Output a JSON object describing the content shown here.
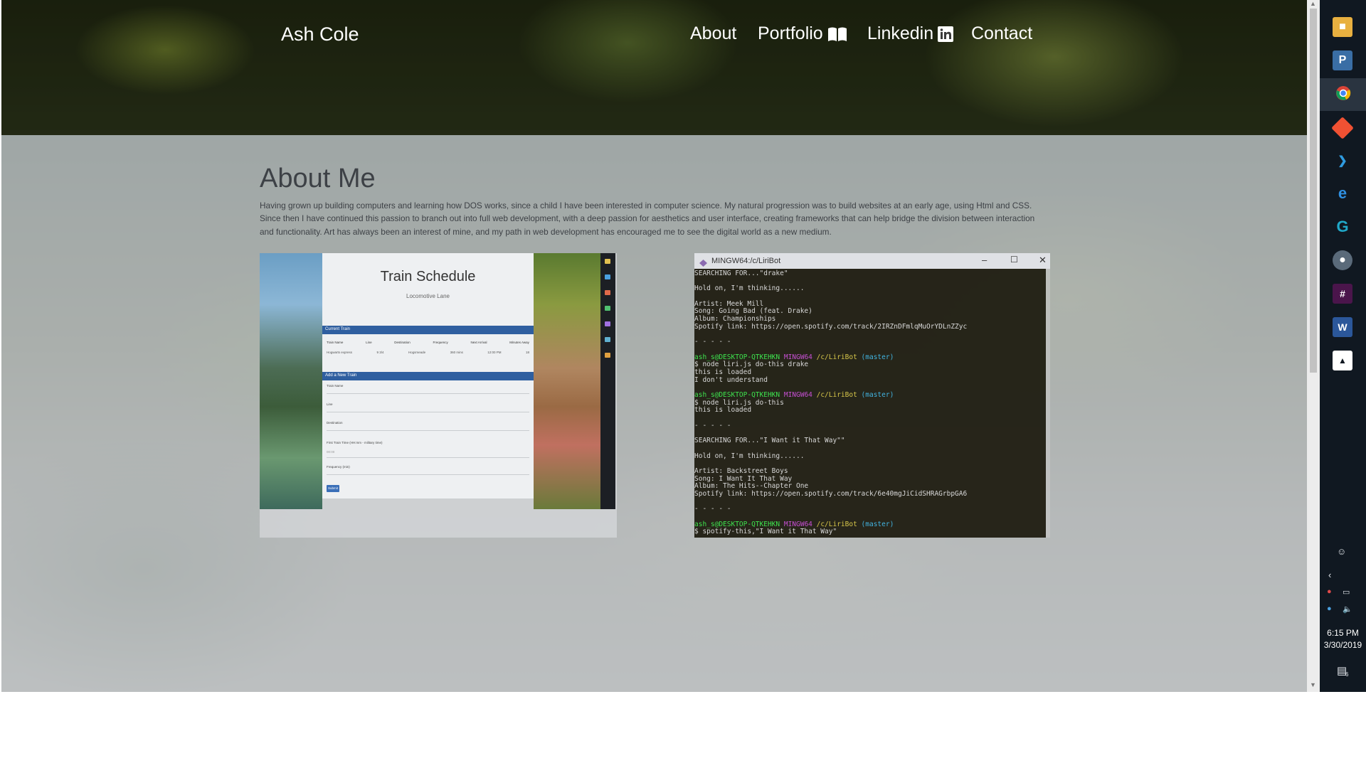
{
  "site": {
    "brand": "Ash Cole",
    "nav": [
      {
        "label": "About",
        "icon": null
      },
      {
        "label": "Portfolio",
        "icon": "book-icon"
      },
      {
        "label": "Linkedin",
        "icon": "linkedin-icon"
      },
      {
        "label": "Contact",
        "icon": null
      }
    ]
  },
  "about": {
    "title": "About Me",
    "paragraph": "Having grown up building computers and learning how DOS works, since a child I have been interested in computer science. My natural progression was to build websites at an early age, using Html and CSS. Since then I have continued this passion to branch out into full web development, with a deep passion for aesthetics and user interface, creating frameworks that can help bridge the division between interaction and functionality. Art has always been an interest of mine, and my path in web development has encouraged me to see the digital world as a new medium."
  },
  "portfolio": {
    "train_schedule": {
      "title": "Train Schedule",
      "subtitle": "Locomotive Lane",
      "current_panel": "Current Train",
      "columns": [
        "Train Name",
        "Line",
        "Destination",
        "Frequency",
        "Next Arrival",
        "Minutes Away"
      ],
      "row": [
        "Hogwarts express",
        "9 3/4",
        "Hogsmeade",
        "360 mins",
        "12:00 PM",
        "18"
      ],
      "add_panel": "Add a New Train",
      "fields": [
        "Train Name",
        "Line",
        "Destination",
        "First Train Time (HH:mm - military time)",
        "Frequency (min)"
      ],
      "time_placeholder": "00:00",
      "submit": "Submit"
    },
    "terminal": {
      "window_title": "MINGW64:/c/LiriBot",
      "lines": [
        [
          {
            "t": "SEARCHING FOR...\"drake\""
          }
        ],
        [
          {
            "t": ""
          }
        ],
        [
          {
            "t": "Hold on, I'm thinking......"
          }
        ],
        [
          {
            "t": ""
          }
        ],
        [
          {
            "t": "Artist: Meek Mill"
          }
        ],
        [
          {
            "t": "Song: Going Bad (feat. Drake)"
          }
        ],
        [
          {
            "t": "Album: Championships"
          }
        ],
        [
          {
            "t": "Spotify link: https://open.spotify.com/track/2IRZnDFmlqMuOrYDLnZZyc"
          }
        ],
        [
          {
            "t": ""
          }
        ],
        [
          {
            "t": "- - - - -"
          }
        ],
        [
          {
            "t": ""
          }
        ],
        [
          {
            "t": "ash_s@DESKTOP-QTKEHKN ",
            "c": "g"
          },
          {
            "t": "MINGW64 ",
            "c": "m"
          },
          {
            "t": "/c/LiriBot ",
            "c": "y"
          },
          {
            "t": "(master)",
            "c": "c"
          }
        ],
        [
          {
            "t": "$ node liri.js do-this drake"
          }
        ],
        [
          {
            "t": "this is loaded"
          }
        ],
        [
          {
            "t": "I don't understand"
          }
        ],
        [
          {
            "t": ""
          }
        ],
        [
          {
            "t": "ash_s@DESKTOP-QTKEHKN ",
            "c": "g"
          },
          {
            "t": "MINGW64 ",
            "c": "m"
          },
          {
            "t": "/c/LiriBot ",
            "c": "y"
          },
          {
            "t": "(master)",
            "c": "c"
          }
        ],
        [
          {
            "t": "$ node liri.js do-this"
          }
        ],
        [
          {
            "t": "this is loaded"
          }
        ],
        [
          {
            "t": ""
          }
        ],
        [
          {
            "t": "- - - - -"
          }
        ],
        [
          {
            "t": ""
          }
        ],
        [
          {
            "t": "SEARCHING FOR...\"I Want it That Way\"\""
          }
        ],
        [
          {
            "t": ""
          }
        ],
        [
          {
            "t": "Hold on, I'm thinking......"
          }
        ],
        [
          {
            "t": ""
          }
        ],
        [
          {
            "t": "Artist: Backstreet Boys"
          }
        ],
        [
          {
            "t": "Song: I Want It That Way"
          }
        ],
        [
          {
            "t": "Album: The Hits--Chapter One"
          }
        ],
        [
          {
            "t": "Spotify link: https://open.spotify.com/track/6e40mgJiCidSHRAGrbpGA6"
          }
        ],
        [
          {
            "t": ""
          }
        ],
        [
          {
            "t": "- - - - -"
          }
        ],
        [
          {
            "t": ""
          }
        ],
        [
          {
            "t": "ash_s@DESKTOP-QTKEHKN ",
            "c": "g"
          },
          {
            "t": "MINGW64 ",
            "c": "m"
          },
          {
            "t": "/c/LiriBot ",
            "c": "y"
          },
          {
            "t": "(master)",
            "c": "c"
          }
        ],
        [
          {
            "t": "$ spotify-this,\"I Want it That Way\""
          }
        ]
      ]
    }
  },
  "taskbar": {
    "apps": [
      "file-explorer-icon",
      "python-icon",
      "chrome-icon",
      "git-icon",
      "vscode-icon",
      "edge-icon",
      "gitkraken-icon",
      "robot-icon",
      "slack-icon",
      "word-icon",
      "photos-icon"
    ],
    "time": "6:15 PM",
    "date": "3/30/2019",
    "notifications": "6"
  },
  "colors": {
    "main_overlay": "#cdd4dc",
    "text": "#3d4146",
    "taskbar": "#101821",
    "terminal_green": "#3ee24e",
    "terminal_magenta": "#c64fd3",
    "terminal_yellow": "#d7c64a",
    "terminal_cyan": "#42b3e0"
  }
}
